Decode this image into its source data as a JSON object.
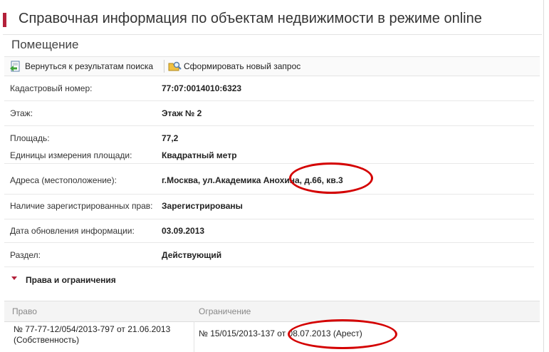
{
  "header": {
    "title": "Справочная информация по объектам недвижимости в режиме online",
    "accent_color": "#b3203a"
  },
  "section": {
    "title": "Помещение"
  },
  "toolbar": {
    "back_label": "Вернуться к результатам поиска",
    "new_request_label": "Сформировать новый запрос"
  },
  "fields": [
    {
      "label": "Кадастровый номер:",
      "value": "77:07:0014010:6323"
    },
    {
      "label": "Этаж:",
      "value": "Этаж № 2"
    },
    {
      "label": "Площадь:",
      "value": "77,2"
    },
    {
      "label": "Единицы измерения площади:",
      "value": "Квадратный метр"
    },
    {
      "label": "Адреса (местоположение):",
      "value": "г.Москва, ул.Академика Анохина, д.66, кв.3"
    },
    {
      "label": "Наличие зарегистрированных прав:",
      "value": "Зарегистрированы"
    },
    {
      "label": "Дата обновления информации:",
      "value": "03.09.2013"
    },
    {
      "label": "Раздел:",
      "value": "Действующий"
    }
  ],
  "rights": {
    "title": "Права и ограничения",
    "col_right": "Право",
    "col_restriction": "Ограничение",
    "row": {
      "right_line1": "№ 77-77-12/054/2013-797  от 21.06.2013",
      "right_line2": "(Собственность)",
      "restriction": "№ 15/015/2013-137  от 08.07.2013  (Арест)"
    }
  },
  "annotation_color": "#d40000"
}
